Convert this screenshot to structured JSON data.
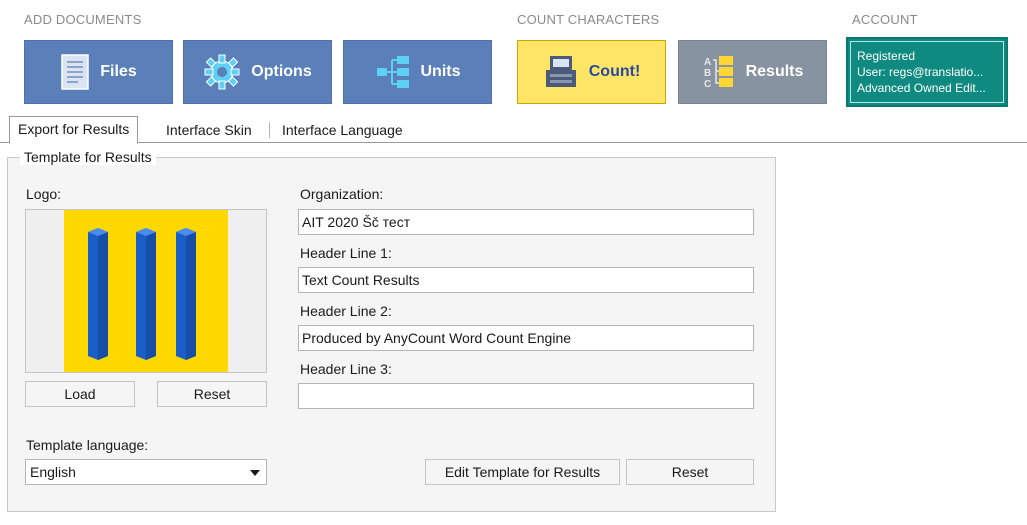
{
  "ribbon": {
    "add_documents_label": "ADD DOCUMENTS",
    "count_characters_label": "COUNT CHARACTERS",
    "account_label": "ACCOUNT",
    "buttons": {
      "files": "Files",
      "options": "Options",
      "units": "Units",
      "count": "Count!",
      "results": "Results"
    },
    "icons": {
      "files": "document-icon",
      "options": "gear-icon",
      "units": "tree-icon",
      "count": "counter-machine-icon",
      "results": "abc-list-icon"
    },
    "colors": {
      "blue": "#5b7fb8",
      "yellow": "#ffe566",
      "gray": "#8793a0",
      "teal": "#0f8a80"
    }
  },
  "account": {
    "status": "Registered",
    "user": "User: regs@translatio...",
    "license": "Advanced Owned Edit..."
  },
  "tabs": [
    {
      "label": "Export  for Results",
      "active": true
    },
    {
      "label": "Interface Skin",
      "active": false
    },
    {
      "label": "Interface Language",
      "active": false
    }
  ],
  "template": {
    "legend": "Template for Results",
    "logo_label": "Logo:",
    "load_button": "Load",
    "reset_logo_button": "Reset",
    "language_label": "Template language:",
    "language_value": "English",
    "organization_label": "Organization:",
    "organization_value": "AIT 2020 Šč тест",
    "header1_label": "Header Line 1:",
    "header1_value": "Text Count Results",
    "header2_label": "Header Line 2:",
    "header2_value": "Produced by AnyCount Word Count Engine",
    "header3_label": "Header Line 3:",
    "header3_value": "",
    "edit_template_button": "Edit Template for Results",
    "reset_button": "Reset"
  }
}
